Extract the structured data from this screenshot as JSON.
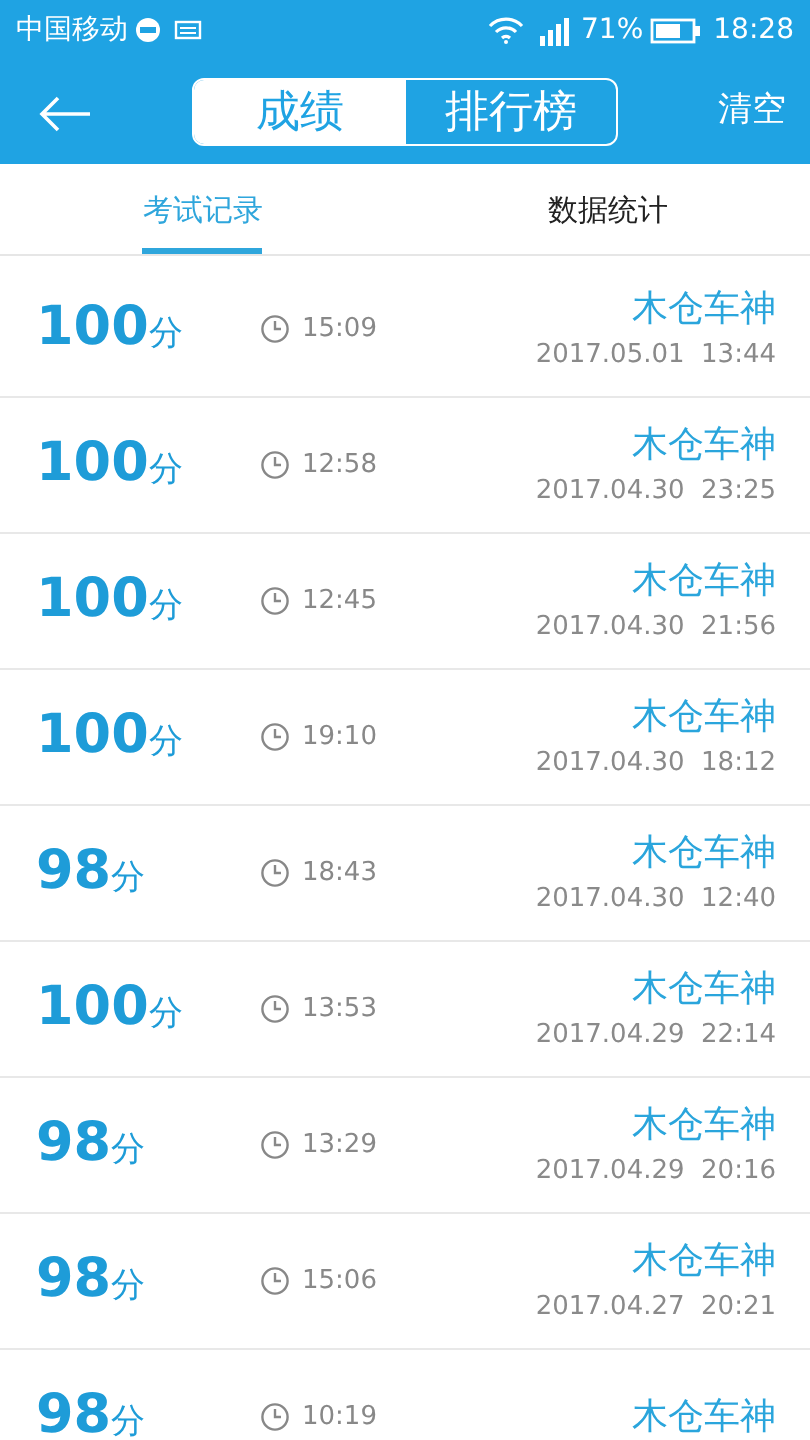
{
  "status_bar": {
    "carrier": "中国移动",
    "battery": "71%",
    "time": "18:28"
  },
  "header": {
    "segments": [
      {
        "label": "成绩",
        "selected": true
      },
      {
        "label": "排行榜",
        "selected": false
      }
    ],
    "action": "清空"
  },
  "tabs": [
    {
      "label": "考试记录",
      "selected": true
    },
    {
      "label": "数据统计",
      "selected": false
    }
  ],
  "records": [
    {
      "score": "100",
      "unit": "分",
      "duration": "15:09",
      "name": "木仓车神",
      "date": "2017.05.01  13:44"
    },
    {
      "score": "100",
      "unit": "分",
      "duration": "12:58",
      "name": "木仓车神",
      "date": "2017.04.30  23:25"
    },
    {
      "score": "100",
      "unit": "分",
      "duration": "12:45",
      "name": "木仓车神",
      "date": "2017.04.30  21:56"
    },
    {
      "score": "100",
      "unit": "分",
      "duration": "19:10",
      "name": "木仓车神",
      "date": "2017.04.30  18:12"
    },
    {
      "score": "98",
      "unit": "分",
      "duration": "18:43",
      "name": "木仓车神",
      "date": "2017.04.30  12:40"
    },
    {
      "score": "100",
      "unit": "分",
      "duration": "13:53",
      "name": "木仓车神",
      "date": "2017.04.29  22:14"
    },
    {
      "score": "98",
      "unit": "分",
      "duration": "13:29",
      "name": "木仓车神",
      "date": "2017.04.29  20:16"
    },
    {
      "score": "98",
      "unit": "分",
      "duration": "15:06",
      "name": "木仓车神",
      "date": "2017.04.27  20:21"
    },
    {
      "score": "98",
      "unit": "分",
      "duration": "10:19",
      "name": "木仓车神"
    }
  ]
}
